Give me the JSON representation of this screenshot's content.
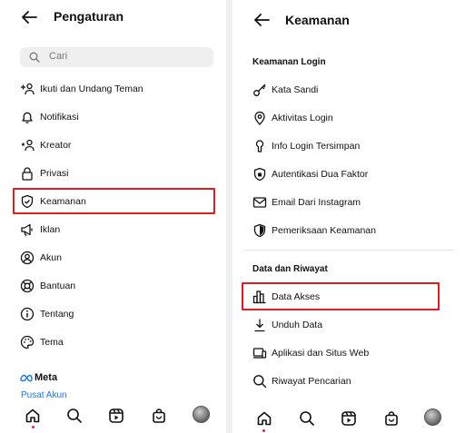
{
  "left": {
    "title": "Pengaturan",
    "search_placeholder": "Cari",
    "items": [
      {
        "label": "Ikuti dan Undang Teman",
        "icon": "add-person-icon"
      },
      {
        "label": "Notifikasi",
        "icon": "bell-icon"
      },
      {
        "label": "Kreator",
        "icon": "creator-icon"
      },
      {
        "label": "Privasi",
        "icon": "lock-icon"
      },
      {
        "label": "Keamanan",
        "icon": "shield-icon"
      },
      {
        "label": "Iklan",
        "icon": "megaphone-icon"
      },
      {
        "label": "Akun",
        "icon": "account-icon"
      },
      {
        "label": "Bantuan",
        "icon": "lifebuoy-icon"
      },
      {
        "label": "Tentang",
        "icon": "info-icon"
      },
      {
        "label": "Tema",
        "icon": "palette-icon"
      }
    ],
    "meta_logo": "Meta",
    "pusat_akun": "Pusat Akun"
  },
  "right": {
    "title": "Keamanan",
    "section_login": "Keamanan Login",
    "login_items": [
      {
        "label": "Kata Sandi",
        "icon": "key-icon"
      },
      {
        "label": "Aktivitas Login",
        "icon": "location-pin-icon"
      },
      {
        "label": "Info Login Tersimpan",
        "icon": "keyhole-icon"
      },
      {
        "label": "Autentikasi Dua Faktor",
        "icon": "two-factor-shield-icon"
      },
      {
        "label": "Email Dari Instagram",
        "icon": "mail-icon"
      },
      {
        "label": "Pemeriksaan Keamanan",
        "icon": "shield-check-icon"
      }
    ],
    "section_data": "Data dan Riwayat",
    "data_items": [
      {
        "label": "Data Akses",
        "icon": "bar-chart-icon"
      },
      {
        "label": "Unduh Data",
        "icon": "download-icon"
      },
      {
        "label": "Aplikasi dan Situs Web",
        "icon": "devices-icon"
      },
      {
        "label": "Riwayat Pencarian",
        "icon": "search-icon"
      }
    ]
  },
  "highlight_color": "#d81f26",
  "link_color": "#1877f2"
}
